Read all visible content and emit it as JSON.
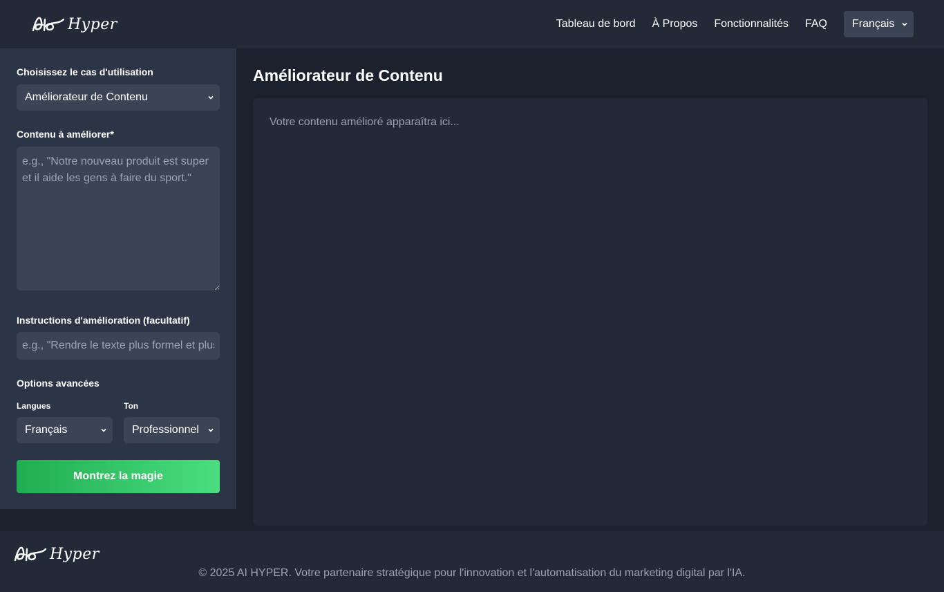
{
  "header": {
    "logo_text": "Hyper",
    "nav": [
      "Tableau de bord",
      "À Propos",
      "Fonctionnalités",
      "FAQ"
    ],
    "language": "Français"
  },
  "sidebar": {
    "use_case_label": "Choisissez le cas d'utilisation",
    "use_case_value": "Améliorateur de Contenu",
    "content_label": "Contenu à améliorer*",
    "content_placeholder": "e.g., \"Notre nouveau produit est super et il aide les gens à faire du sport.\"",
    "instructions_label": "Instructions d'amélioration (facultatif)",
    "instructions_placeholder": "e.g., \"Rendre le texte plus formel et plus persuasif\"",
    "advanced_label": "Options avancées",
    "languages_label": "Langues",
    "languages_value": "Français",
    "tone_label": "Ton",
    "tone_value": "Professionnel",
    "submit_label": "Montrez la magie"
  },
  "main": {
    "title": "Améliorateur de Contenu",
    "output_placeholder": "Votre contenu amélioré apparaîtra ici..."
  },
  "footer": {
    "logo_text": "Hyper",
    "copyright": "© 2025 AI HYPER. Votre partenaire stratégique pour l'innovation et l'automatisation du marketing digital par l'IA."
  },
  "colors": {
    "accent_start": "#21ad52",
    "accent_end": "#4ade80",
    "panel": "#2c3545",
    "field": "#3a4455"
  }
}
